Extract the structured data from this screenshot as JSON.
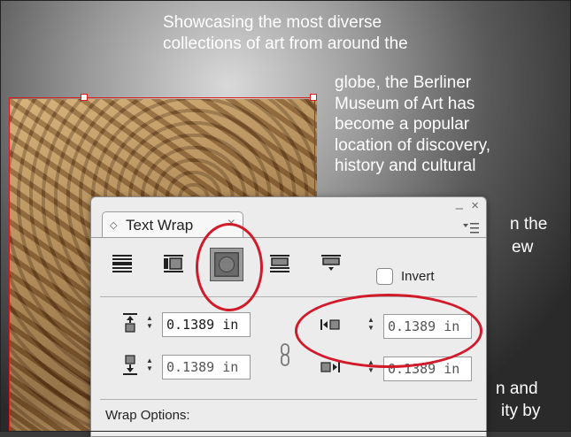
{
  "document": {
    "body_text_top": [
      "Showcasing the most diverse",
      "collections of art from around the"
    ],
    "body_text_side": [
      "globe, the Berliner",
      "Museum of Art has",
      "become a popular",
      "location of discovery,",
      "history and cultural"
    ],
    "peek_lines": [
      "n the",
      "ew",
      "n and",
      "ity by"
    ]
  },
  "panel": {
    "tab_label": "Text Wrap",
    "tab_close": "×",
    "minimize": "–",
    "close": "×",
    "menu_icon": "panel-menu-icon",
    "wrap_modes": [
      {
        "name": "no-text-wrap",
        "selected": false
      },
      {
        "name": "wrap-around-bounding-box",
        "selected": false
      },
      {
        "name": "wrap-around-object-shape",
        "selected": true
      },
      {
        "name": "jump-object",
        "selected": false
      },
      {
        "name": "jump-to-next-column",
        "selected": false
      }
    ],
    "invert_label": "Invert",
    "invert_checked": false,
    "offsets": {
      "top": "0.1389 in",
      "bottom": "0.1389 in",
      "left": "0.1389 in",
      "right": "0.1389 in"
    },
    "wrap_options_label": "Wrap Options:"
  },
  "colors": {
    "frame": "#e01818",
    "highlight": "#d11a2a",
    "panel_bg": "#ececec"
  }
}
